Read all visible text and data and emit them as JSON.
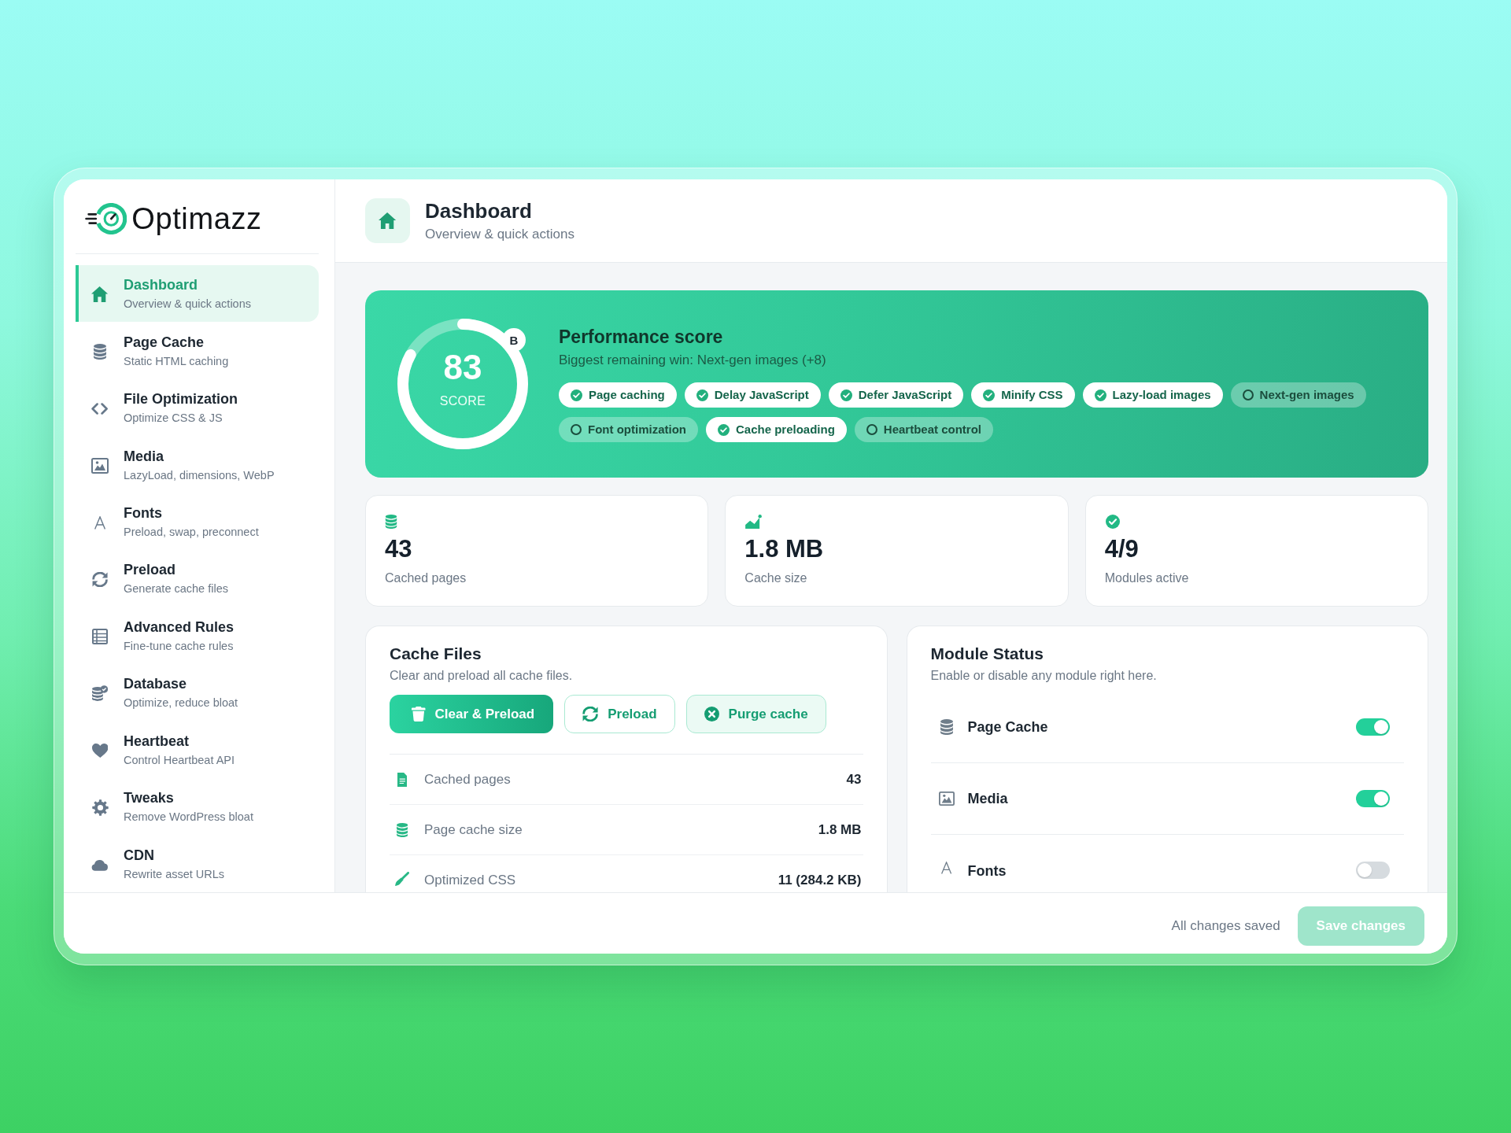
{
  "app": {
    "brand": "Optimazz"
  },
  "sidebar": {
    "items": [
      {
        "title": "Dashboard",
        "subtitle": "Overview & quick actions",
        "selected": true
      },
      {
        "title": "Page Cache",
        "subtitle": "Static HTML caching",
        "selected": false
      },
      {
        "title": "File Optimization",
        "subtitle": "Optimize CSS & JS",
        "selected": false
      },
      {
        "title": "Media",
        "subtitle": "LazyLoad, dimensions, WebP",
        "selected": false
      },
      {
        "title": "Fonts",
        "subtitle": "Preload, swap, preconnect",
        "selected": false
      },
      {
        "title": "Preload",
        "subtitle": "Generate cache files",
        "selected": false
      },
      {
        "title": "Advanced Rules",
        "subtitle": "Fine-tune cache rules",
        "selected": false
      },
      {
        "title": "Database",
        "subtitle": "Optimize, reduce bloat",
        "selected": false
      },
      {
        "title": "Heartbeat",
        "subtitle": "Control Heartbeat API",
        "selected": false
      },
      {
        "title": "Tweaks",
        "subtitle": "Remove WordPress bloat",
        "selected": false
      },
      {
        "title": "CDN",
        "subtitle": "Rewrite asset URLs",
        "selected": false
      }
    ]
  },
  "header": {
    "title": "Dashboard",
    "subtitle": "Overview & quick actions"
  },
  "performance": {
    "score": "83",
    "score_label": "SCORE",
    "level": 0.83,
    "grade": "B",
    "title": "Performance score",
    "subtitle": "Biggest remaining win: Next-gen images (+8)",
    "checks": [
      {
        "label": "Page caching",
        "checked": true
      },
      {
        "label": "Delay JavaScript",
        "checked": true
      },
      {
        "label": "Defer JavaScript",
        "checked": true
      },
      {
        "label": "Minify CSS",
        "checked": true
      },
      {
        "label": "Lazy-load images",
        "checked": true
      },
      {
        "label": "Next-gen images",
        "checked": false
      },
      {
        "label": "Font optimization",
        "checked": false
      },
      {
        "label": "Cache preloading",
        "checked": true
      },
      {
        "label": "Heartbeat control",
        "checked": false
      }
    ]
  },
  "stats": [
    {
      "value": "43",
      "label": "Cached pages"
    },
    {
      "value": "1.8 MB",
      "label": "Cache size"
    },
    {
      "value": "4/9",
      "label": "Modules active"
    }
  ],
  "cache_files": {
    "title": "Cache Files",
    "subtitle": "Clear and preload all cache files.",
    "buttons": [
      {
        "label": "Clear & Preload",
        "kind": "primary"
      },
      {
        "label": "Preload",
        "kind": "outline"
      },
      {
        "label": "Purge cache",
        "kind": "soft"
      }
    ],
    "rows": [
      {
        "label": "Cached pages",
        "value": "43"
      },
      {
        "label": "Page cache size",
        "value": "1.8 MB"
      },
      {
        "label": "Optimized CSS",
        "value": "11 (284.2 KB)"
      }
    ]
  },
  "module_status": {
    "title": "Module Status",
    "subtitle": "Enable or disable any module right here.",
    "modules": [
      {
        "name": "Page Cache",
        "on": true
      },
      {
        "name": "Media",
        "on": true
      },
      {
        "name": "Fonts",
        "on": false
      }
    ]
  },
  "footer": {
    "status": "All changes saved",
    "save_button": {
      "label": "Save changes",
      "disabled": true
    }
  }
}
